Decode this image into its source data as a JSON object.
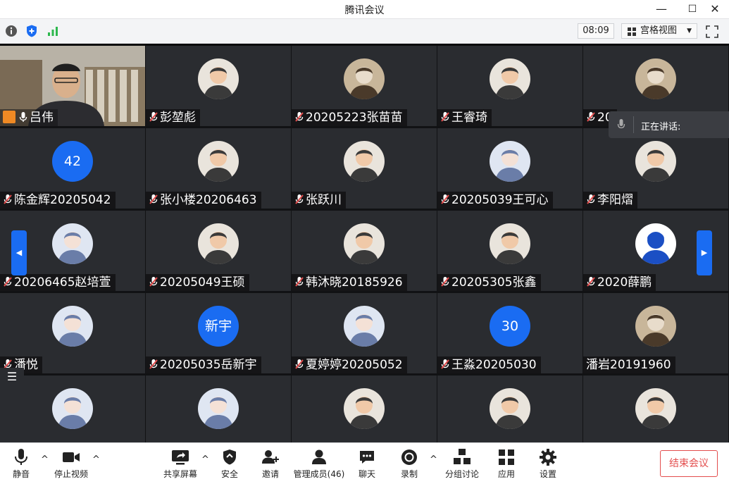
{
  "window": {
    "title": "腾讯会议",
    "minimize": "—",
    "maximize": "☐",
    "close": "✕"
  },
  "toolbar": {
    "time": "08:09",
    "view_label": "宫格视图"
  },
  "speaking": {
    "label": "正在讲话:"
  },
  "tiles": [
    {
      "name": "吕伟",
      "avatar": "camera"
    },
    {
      "name": "彭堃彪",
      "avatar": "photo"
    },
    {
      "name": "20205223张苗苗",
      "avatar": "cat"
    },
    {
      "name": "王睿琦",
      "avatar": "photo"
    },
    {
      "name": "20",
      "avatar": "cat"
    },
    {
      "name": "陈金辉20205042",
      "avatar": "text",
      "avatar_text": "42"
    },
    {
      "name": "张小楼20206463",
      "avatar": "photo"
    },
    {
      "name": "张跃川",
      "avatar": "photo"
    },
    {
      "name": "20205039王可心",
      "avatar": "anime"
    },
    {
      "name": "李阳熠",
      "avatar": "photo"
    },
    {
      "name": "20206465赵培萱",
      "avatar": "anime"
    },
    {
      "name": "20205049王硕",
      "avatar": "photo"
    },
    {
      "name": "韩沐晓20185926",
      "avatar": "photo"
    },
    {
      "name": "20205305张鑫",
      "avatar": "photo"
    },
    {
      "name": "2020薛鹏",
      "avatar": "blue"
    },
    {
      "name": "潘悦",
      "avatar": "anime"
    },
    {
      "name": "20205035岳新宇",
      "avatar": "text",
      "avatar_text": "新宇"
    },
    {
      "name": "夏婷婷20205052",
      "avatar": "anime"
    },
    {
      "name": "王淼20205030",
      "avatar": "text",
      "avatar_text": "30"
    },
    {
      "name": "潘岩20191960",
      "avatar": "cat"
    },
    {
      "name": "",
      "avatar": "anime"
    },
    {
      "name": "",
      "avatar": "anime"
    },
    {
      "name": "",
      "avatar": "photo"
    },
    {
      "name": "",
      "avatar": "photo"
    },
    {
      "name": "",
      "avatar": "photo"
    }
  ],
  "bottombar": {
    "mute": "静音",
    "stop_video": "停止视频",
    "share": "共享屏幕",
    "security": "安全",
    "invite": "邀请",
    "members": "管理成员(46)",
    "chat": "聊天",
    "record": "录制",
    "breakout": "分组讨论",
    "apps": "应用",
    "settings": "设置",
    "end": "结束会议"
  },
  "colors": {
    "accent": "#1a6cf2",
    "end": "#e34d4d",
    "tile": "#2a2c30"
  }
}
